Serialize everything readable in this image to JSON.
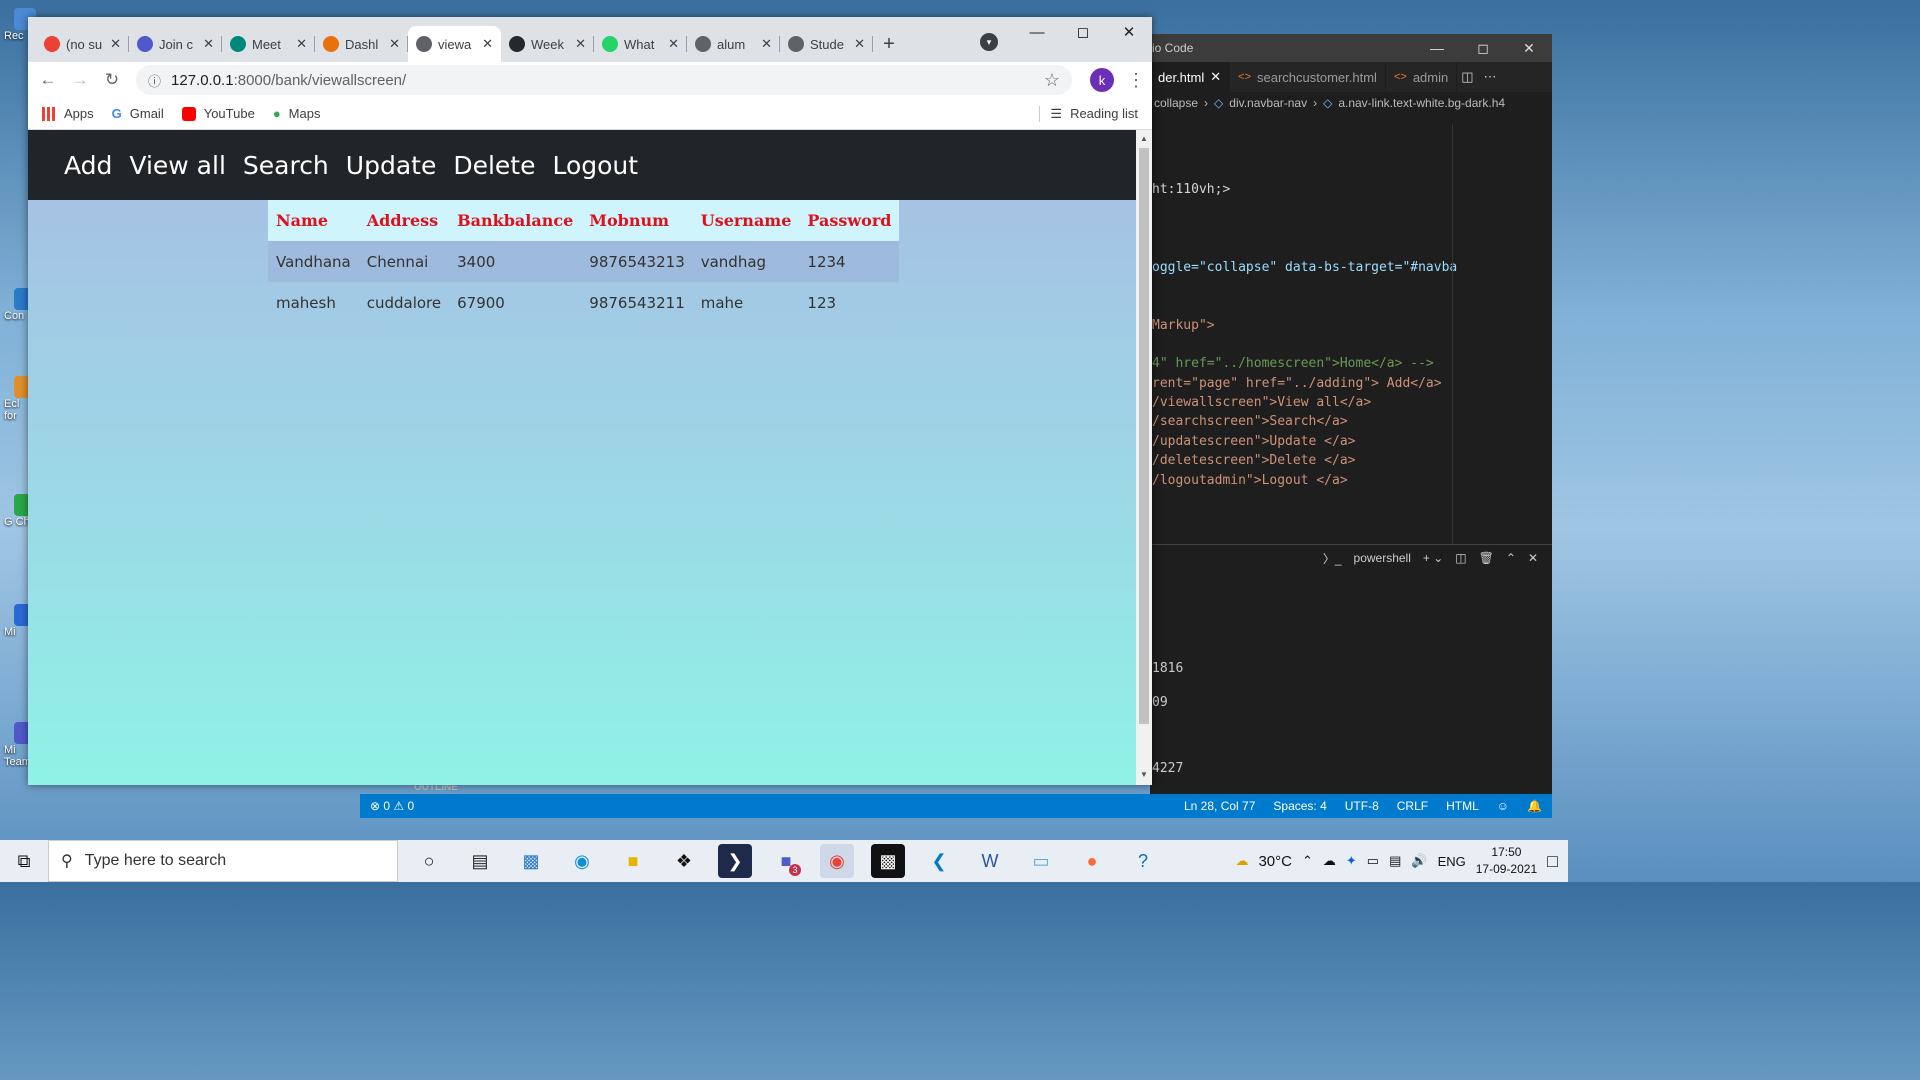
{
  "desktop": {
    "icons": [
      {
        "label": "Rec",
        "color": "#4a8ad6"
      },
      {
        "label": "Con",
        "color": "#2a7ac8"
      },
      {
        "label": "Ecl for",
        "color": "#e0902a"
      },
      {
        "label": "G Ch",
        "color": "#2aa84a"
      },
      {
        "label": "Mi",
        "color": "#2a6ad6"
      },
      {
        "label": "Mi Teams",
        "color": "#5059c9"
      }
    ]
  },
  "vscode": {
    "title": "io Code",
    "tabs": [
      {
        "label": "der.html",
        "active": true
      },
      {
        "label": "searchcustomer.html",
        "active": false
      },
      {
        "label": "admin",
        "active": false
      }
    ],
    "breadcrumb": [
      "collapse",
      "div.navbar-nav",
      "a.nav-link.text-white.bg-dark.h4"
    ],
    "code": [
      "ht:110vh;>",
      "oggle=\"collapse\" data-bs-target=\"#navba",
      "Markup\">",
      "4\" href=\"../homescreen\">Home</a> -->",
      "rent=\"page\" href=\"../adding\"> Add</a>",
      "/viewallscreen\">View all</a>",
      "/searchscreen\">Search</a>",
      "/updatescreen\">Update </a>",
      "/deletescreen\">Delete </a>",
      "/logoutadmin\">Logout </a>"
    ],
    "terminal_label": "powershell",
    "terminal_lines": [
      "1816",
      "09",
      "4227"
    ],
    "outline_label": "OUTLINE",
    "status": {
      "errors": "0",
      "warnings": "0",
      "position": "Ln 28, Col 77",
      "spaces": "Spaces: 4",
      "encoding": "UTF-8",
      "eol": "CRLF",
      "language": "HTML"
    }
  },
  "chrome": {
    "tabs": [
      {
        "label": "(no su",
        "icon": "gmail-icon",
        "color": "#ea4335",
        "active": false
      },
      {
        "label": "Join c",
        "icon": "teams-icon",
        "color": "#5059c9",
        "active": false
      },
      {
        "label": "Meet",
        "icon": "meet-icon",
        "color": "#00897b",
        "active": false
      },
      {
        "label": "Dashl",
        "icon": "dashboard-icon",
        "color": "#e8710a",
        "active": false
      },
      {
        "label": "viewa",
        "icon": "globe-icon",
        "color": "#5f6368",
        "active": true
      },
      {
        "label": "Week",
        "icon": "github-icon",
        "color": "#24292e",
        "active": false
      },
      {
        "label": "What",
        "icon": "whatsapp-icon",
        "color": "#25d366",
        "active": false
      },
      {
        "label": "alum",
        "icon": "globe-icon",
        "color": "#5f6368",
        "active": false
      },
      {
        "label": "Stude",
        "icon": "globe-icon",
        "color": "#5f6368",
        "active": false
      }
    ],
    "url_host": "127.0.0.1",
    "url_path": ":8000/bank/viewallscreen/",
    "profile_initial": "k",
    "bookmarks": [
      {
        "label": "Apps",
        "icon": "apps-grid-icon"
      },
      {
        "label": "Gmail",
        "icon": "google-g-icon"
      },
      {
        "label": "YouTube",
        "icon": "youtube-icon"
      },
      {
        "label": "Maps",
        "icon": "maps-pin-icon"
      }
    ],
    "reading_list": "Reading list"
  },
  "page": {
    "nav": [
      "Add",
      "View all",
      "Search",
      "Update",
      "Delete",
      "Logout"
    ],
    "table": {
      "headers": [
        "Name",
        "Address",
        "Bankbalance",
        "Mobnum",
        "Username",
        "Password"
      ],
      "rows": [
        [
          "Vandhana",
          "Chennai",
          "3400",
          "9876543213",
          "vandhag",
          "1234"
        ],
        [
          "mahesh",
          "cuddalore",
          "67900",
          "9876543211",
          "mahe",
          "123"
        ]
      ]
    }
  },
  "taskbar": {
    "search_placeholder": "Type here to search",
    "apps": [
      "cortana-icon",
      "task-view-icon",
      "pc-icon",
      "edge-icon",
      "file-explorer-icon",
      "dropbox-icon",
      "powershell-icon",
      "teams-icon",
      "chrome-icon",
      "cmd-icon",
      "vscode-icon",
      "word-icon",
      "notepad-icon",
      "postman-icon",
      "help-icon"
    ],
    "teams_badge": "3",
    "weather": "30°C",
    "language": "ENG",
    "time": "17:50",
    "date": "17-09-2021"
  }
}
